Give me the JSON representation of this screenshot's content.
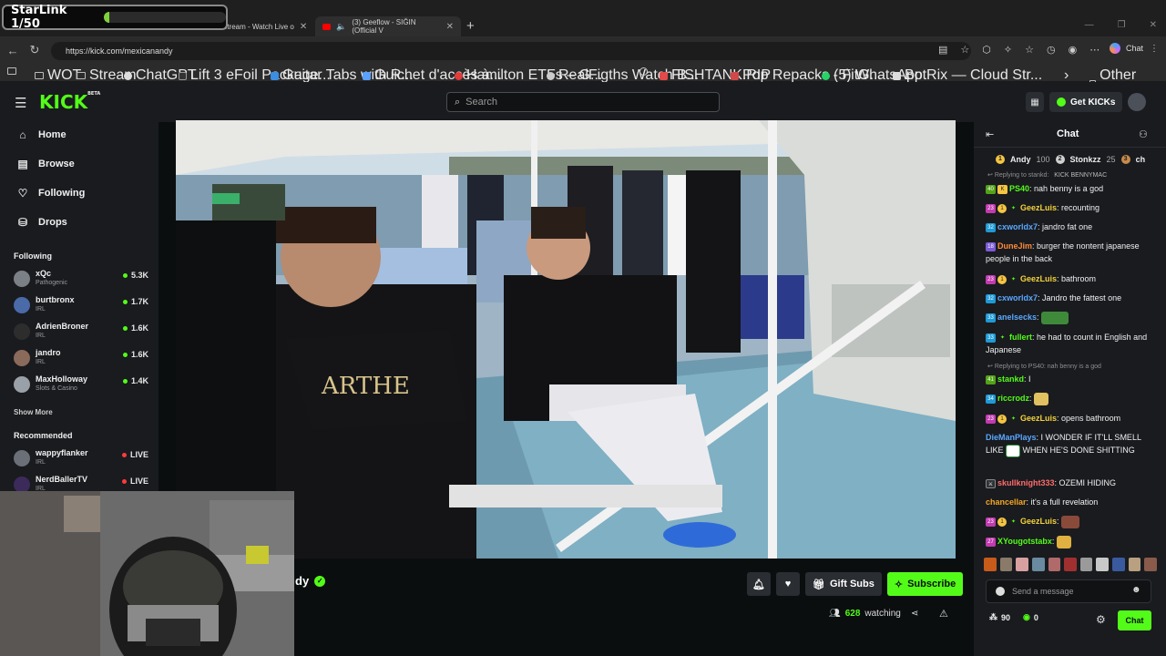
{
  "overlay": {
    "label": "StarLink 1/50",
    "progress": 0.02,
    "color": "#7fd13b"
  },
  "browser": {
    "tabs": [
      {
        "label": "Stream - Watch Live o",
        "close": "✕"
      },
      {
        "label": "(3) Geeflow - SIĞIN (Official V",
        "close": "✕"
      }
    ],
    "new_tab": "+",
    "url": "https://kick.com/mexicanandy",
    "copilot_label": "Chat",
    "bookmarks": [
      "WOT",
      "Stream",
      "ChatGPT",
      "Lift 3 eFoil Package...",
      "Guitar Tabs with R...",
      "Guichet d'accès à...",
      "Hamilton ETFs – G...",
      "RealFigths Watch B...",
      "",
      "FISHTANK.RIP",
      "Pop Repacks - FitG...",
      "(5) WhatsApp",
      "BotRix — Cloud Str..."
    ],
    "other_favourites": "Other favourites"
  },
  "kick": {
    "logo": "KICK",
    "logo_beta": "BETA",
    "search_placeholder": "Search",
    "get_kicks": "Get KICKs",
    "brand_color": "#53fc18"
  },
  "sidebar": {
    "nav": [
      {
        "label": "Home",
        "icon": "home-icon",
        "glyph": "⌂"
      },
      {
        "label": "Browse",
        "icon": "browse-icon",
        "glyph": "▤"
      },
      {
        "label": "Following",
        "icon": "heart-icon",
        "glyph": "♡"
      },
      {
        "label": "Drops",
        "icon": "drops-icon",
        "glyph": "⛁"
      }
    ],
    "following_title": "Following",
    "following": [
      {
        "name": "xQc",
        "category": "Pathogenic",
        "viewers": "5.3K"
      },
      {
        "name": "burtbronx",
        "category": "IRL",
        "viewers": "1.7K"
      },
      {
        "name": "AdrienBroner",
        "category": "IRL",
        "viewers": "1.6K"
      },
      {
        "name": "jandro",
        "category": "IRL",
        "viewers": "1.6K"
      },
      {
        "name": "MaxHolloway",
        "category": "Slots & Casino",
        "viewers": "1.4K"
      }
    ],
    "show_more": "Show More",
    "recommended_title": "Recommended",
    "recommended": [
      {
        "name": "wappyflanker",
        "category": "IRL",
        "status": "LIVE"
      },
      {
        "name": "NerdBallerTV",
        "category": "IRL",
        "status": "LIVE"
      }
    ]
  },
  "stream": {
    "streamer_name": "dy",
    "gift_subs": "Gift Subs",
    "subscribe": "Subscribe",
    "watching_count": "628",
    "watching_label": "watching"
  },
  "chat": {
    "title": "Chat",
    "leaderboard": [
      {
        "name": "Andy",
        "value": "100"
      },
      {
        "name": "Stonkzz",
        "value": "25"
      },
      {
        "name": "ch",
        "value": ""
      }
    ],
    "messages": [
      {
        "reply": "Replying to stankd:",
        "reply_tail": "KICK BENNYMAC"
      },
      {
        "badges": [
          "40"
        ],
        "user": "PS40",
        "color": "#53fc18",
        "text": "nah benny is a god"
      },
      {
        "badges": [
          "23",
          "1"
        ],
        "user": "GeezLuis",
        "color": "#f5d33b",
        "text": "recounting"
      },
      {
        "badges": [
          "32"
        ],
        "user": "cxworldx7",
        "color": "#5ba8ff",
        "text": "jandro fat one"
      },
      {
        "badges": [
          "18"
        ],
        "user": "DuneJim",
        "color": "#ff8a3b",
        "text": "burger the nontent japanese people in the back"
      },
      {
        "badges": [
          "23",
          "1"
        ],
        "user": "GeezLuis",
        "color": "#f5d33b",
        "text": "bathroom"
      },
      {
        "badges": [
          "32"
        ],
        "user": "cxworldx7",
        "color": "#5ba8ff",
        "text": "Jandro the fattest one"
      },
      {
        "badges": [
          "33"
        ],
        "user": "anelsecks",
        "color": "#5ba8ff",
        "text": ""
      },
      {
        "badges": [
          "33"
        ],
        "user": "fullert",
        "color": "#53fc18",
        "text": "he had to count in English and Japanese"
      },
      {
        "reply": "Replying to PS40: nah benny is a god"
      },
      {
        "badges": [
          "41"
        ],
        "user": "stankd",
        "color": "#53fc18",
        "text": "I"
      },
      {
        "badges": [
          "34"
        ],
        "user": "riccrodz",
        "color": "#53fc18",
        "text": ""
      },
      {
        "badges": [
          "23",
          "1"
        ],
        "user": "GeezLuis",
        "color": "#f5d33b",
        "text": "opens bathroom"
      },
      {
        "user": "DieManPlays",
        "color": "#5ba8ff",
        "text": "I WONDER IF IT'LL SMELL LIKE",
        "text2": "WHEN HE'S DONE SHITTING"
      },
      {
        "badges": [
          "mod"
        ],
        "user": "skullknight333",
        "color": "#ff6b6b",
        "text": "OZEMI HIDING"
      },
      {
        "user": "chancellar",
        "color": "#f5a623",
        "text": "it's a full revelation"
      },
      {
        "badges": [
          "23",
          "1"
        ],
        "user": "GeezLuis",
        "color": "#f5d33b",
        "text": ""
      },
      {
        "badges": [
          "27"
        ],
        "user": "XYougotstabx",
        "color": "#53fc18",
        "text": ""
      }
    ],
    "input_placeholder": "Send a message",
    "points": "90",
    "kicks": "0",
    "send": "Chat"
  }
}
